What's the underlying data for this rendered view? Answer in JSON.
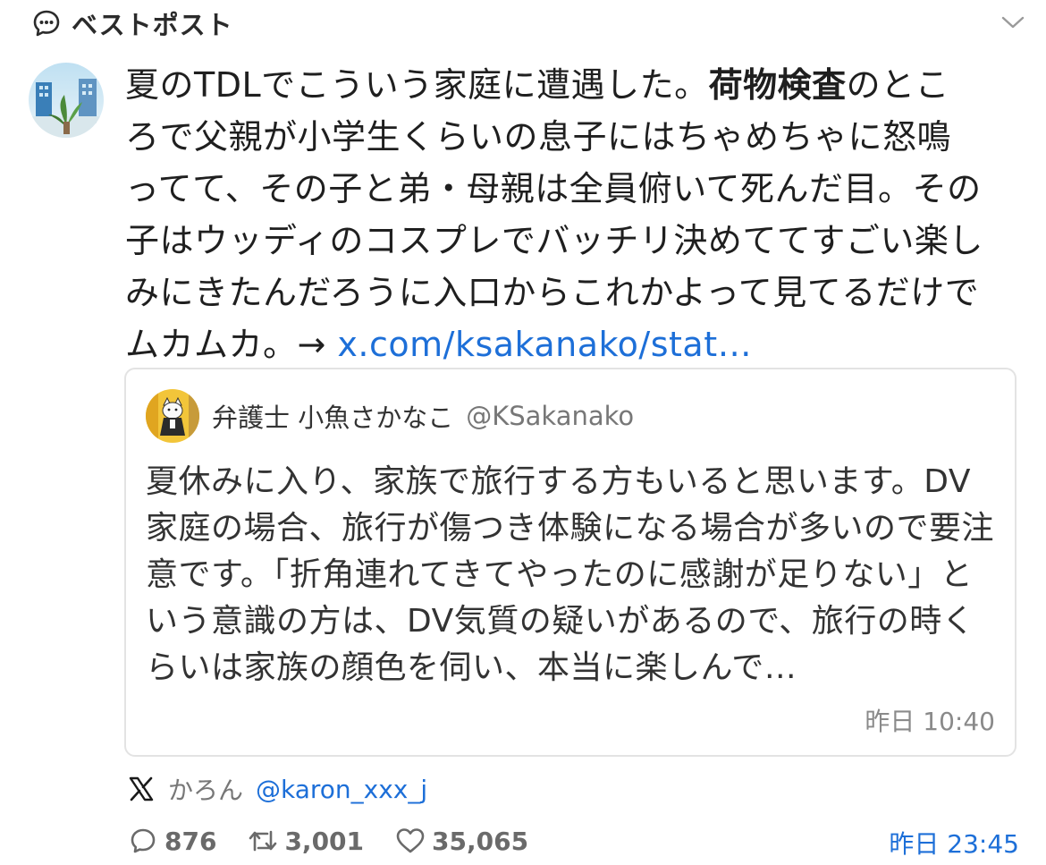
{
  "header": {
    "title": "ベストポスト",
    "icon": "speech-bubble-icon",
    "collapse_icon": "chevron-down-icon"
  },
  "post": {
    "text_part1": "夏のTDLでこういう家庭に遭遇した。",
    "text_strong": "荷物検査",
    "text_part2": "のところで父親が小学生くらいの息子にはちゃめちゃに怒鳴ってて、その子と弟・母親は全員俯いて死んだ目。その子はウッディのコスプレでバッチリ決めててすごい楽しみにきたんだろうに入口からこれかよって見てるだけでムカムカ。→ ",
    "link_text": "x.com/ksakanako/stat…",
    "time": "昨日 23:45"
  },
  "quote": {
    "author_name": "弁護士 小魚さかなこ",
    "author_handle": "@KSakanako",
    "text": "夏休みに入り、家族で旅行する方もいると思います。DV家庭の場合、旅行が傷つき体験になる場合が多いので要注意です。「折角連れてきてやったのに感謝が足りない」という意識の方は、DV気質の疑いがあるので、旅行の時くらいは家族の顔色を伺い、本当に楽しんで…",
    "time": "昨日 10:40"
  },
  "source": {
    "name": "かろん",
    "handle": "@karon_xxx_j",
    "icon": "x-logo-icon"
  },
  "stats": {
    "replies": "876",
    "reposts": "3,001",
    "likes": "35,065"
  },
  "colors": {
    "link": "#1d6fd8",
    "text": "#1f1f1f",
    "muted": "#777777",
    "border": "#e3e3e3"
  }
}
